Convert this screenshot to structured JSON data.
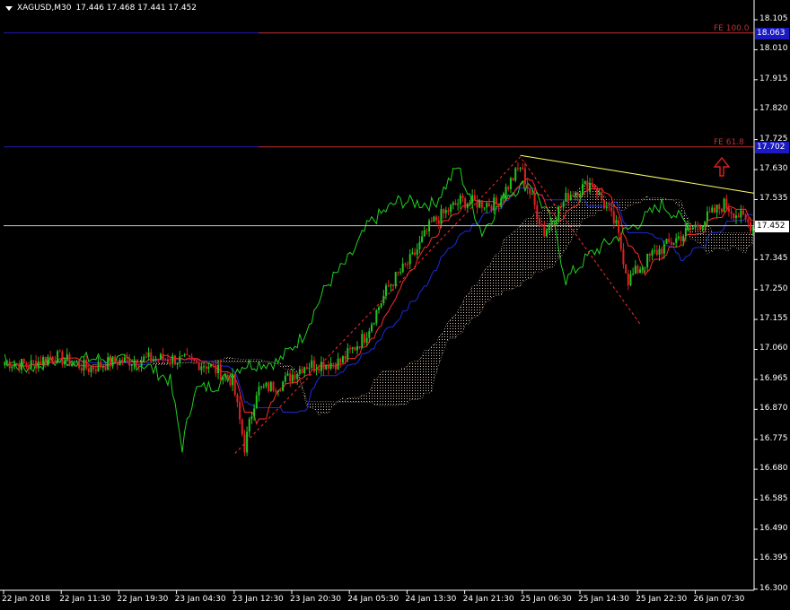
{
  "header": {
    "symbol": "XAGUSD,M30",
    "ohlc": "17.446 17.468 17.441 17.452"
  },
  "colors": {
    "background": "#000000",
    "bull": "#22c322",
    "bear": "#e02020",
    "tenkan": "#ff2a2a",
    "kijun": "#1d2bdc",
    "chikou": "#20d020",
    "kumo": "#d9c5b3",
    "trendline": "#ffff66",
    "fibo": "#c0302f",
    "fibo_blue": "#1a1ac0"
  },
  "chart_data": {
    "type": "candlestick",
    "ylim": [
      16.305,
      18.105
    ],
    "y_ticks": [
      "18.105",
      "18.010",
      "17.915",
      "17.820",
      "17.725",
      "17.630",
      "17.535",
      "17.440",
      "17.345",
      "17.250",
      "17.155",
      "17.060",
      "16.965",
      "16.870",
      "16.775",
      "16.680",
      "16.585",
      "16.490",
      "16.395",
      "16.300"
    ],
    "x_ticks": [
      "22 Jan 2018",
      "22 Jan 11:30",
      "22 Jan 19:30",
      "23 Jan 04:30",
      "23 Jan 12:30",
      "23 Jan 20:30",
      "24 Jan 05:30",
      "24 Jan 13:30",
      "24 Jan 21:30",
      "25 Jan 06:30",
      "25 Jan 14:30",
      "25 Jan 22:30",
      "26 Jan 07:30"
    ],
    "current_price": "17.452",
    "fibo_levels": [
      {
        "label": "FE 100.0",
        "price": 18.063
      },
      {
        "label": "FE 61.8",
        "price": 17.702
      }
    ],
    "close_anchors": [
      [
        0,
        17.02
      ],
      [
        10,
        17.01
      ],
      [
        20,
        17.04
      ],
      [
        35,
        17.0
      ],
      [
        45,
        17.02
      ],
      [
        60,
        17.03
      ],
      [
        70,
        17.03
      ],
      [
        85,
        17.01
      ],
      [
        95,
        16.96
      ],
      [
        100,
        16.75
      ],
      [
        105,
        16.93
      ],
      [
        115,
        16.95
      ],
      [
        125,
        17.01
      ],
      [
        140,
        17.02
      ],
      [
        150,
        17.1
      ],
      [
        160,
        17.26
      ],
      [
        170,
        17.35
      ],
      [
        178,
        17.46
      ],
      [
        190,
        17.53
      ],
      [
        205,
        17.52
      ],
      [
        215,
        17.64
      ],
      [
        225,
        17.43
      ],
      [
        235,
        17.55
      ],
      [
        245,
        17.59
      ],
      [
        255,
        17.45
      ],
      [
        260,
        17.28
      ],
      [
        270,
        17.36
      ],
      [
        280,
        17.41
      ],
      [
        290,
        17.46
      ],
      [
        300,
        17.52
      ],
      [
        312,
        17.45
      ]
    ]
  },
  "arrow_icon": "up-arrow-outline"
}
